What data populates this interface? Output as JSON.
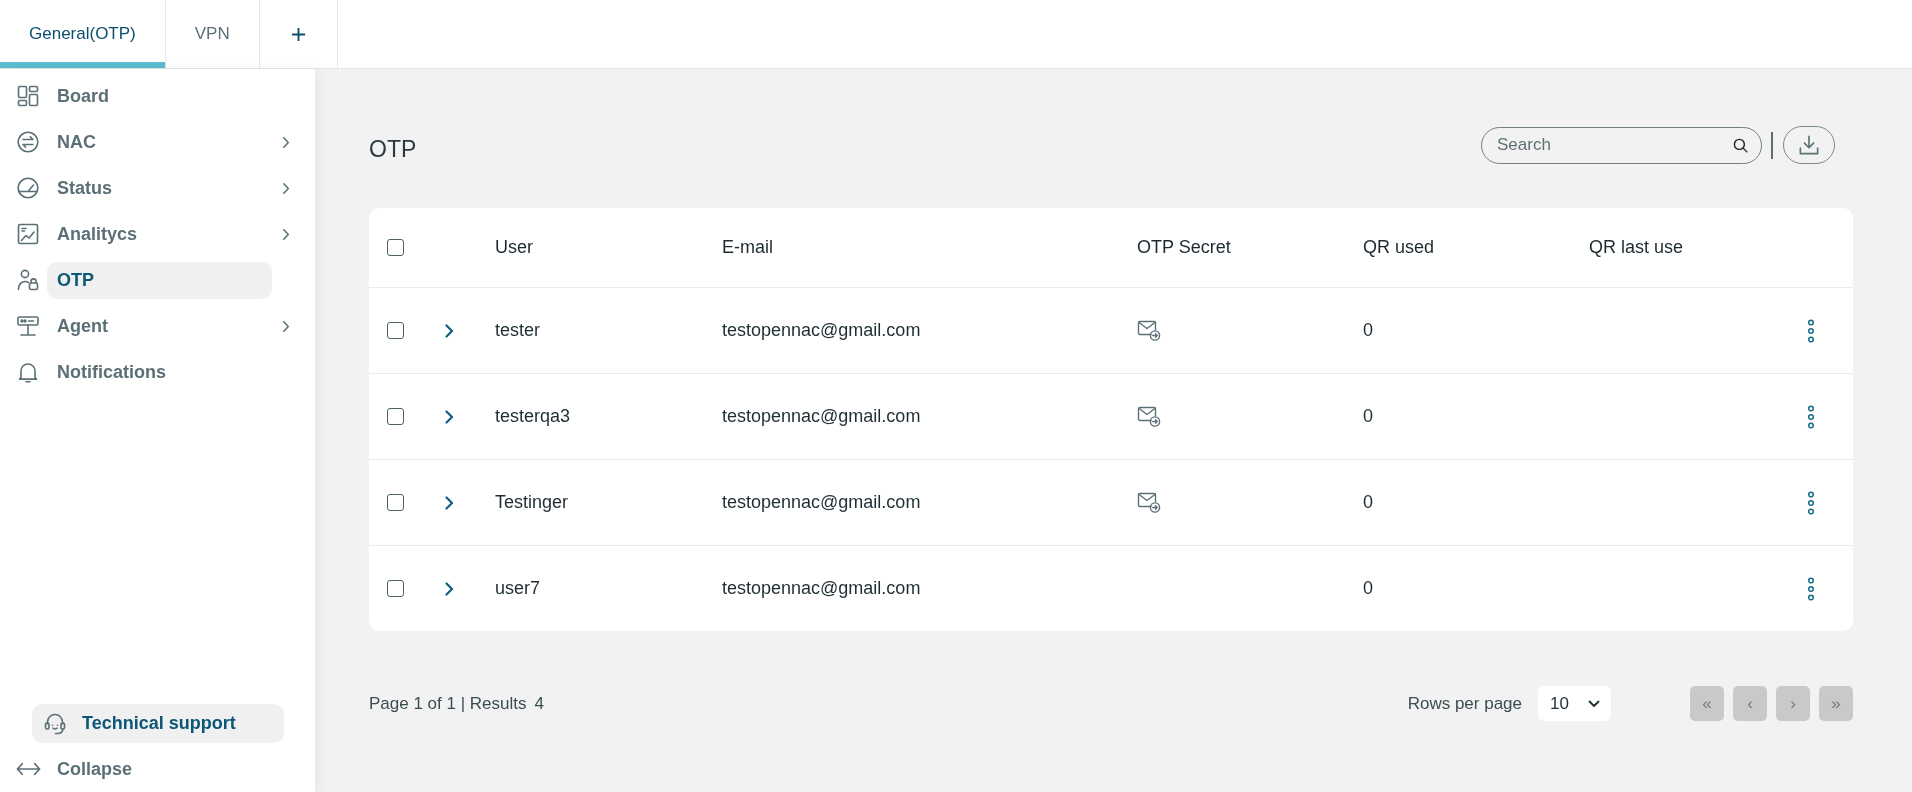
{
  "tabs": [
    {
      "label": "General(OTP)",
      "selected": true
    },
    {
      "label": "VPN",
      "selected": false
    }
  ],
  "sidebar": {
    "items": [
      {
        "label": "Board",
        "selected": false,
        "expandable": false
      },
      {
        "label": "NAC",
        "selected": false,
        "expandable": true
      },
      {
        "label": "Status",
        "selected": false,
        "expandable": true
      },
      {
        "label": "Analitycs",
        "selected": false,
        "expandable": true
      },
      {
        "label": "OTP",
        "selected": true,
        "expandable": false
      },
      {
        "label": "Agent",
        "selected": false,
        "expandable": true
      },
      {
        "label": "Notifications",
        "selected": false,
        "expandable": false
      }
    ],
    "support": {
      "label": "Technical support"
    },
    "collapse": {
      "label": "Collapse"
    }
  },
  "page": {
    "title": "OTP",
    "search": {
      "placeholder": "Search"
    }
  },
  "table": {
    "header_checked": false,
    "columns": [
      "User",
      "E-mail",
      "OTP Secret",
      "QR used",
      "QR last use"
    ],
    "rows": [
      {
        "checked": false,
        "expanded": false,
        "user": "tester",
        "email": "testopennac@gmail.com",
        "otp_secret_set": true,
        "qr_used": "0"
      },
      {
        "checked": false,
        "expanded": false,
        "user": "testerqa3",
        "email": "testopennac@gmail.com",
        "otp_secret_set": true,
        "qr_used": "0"
      },
      {
        "checked": false,
        "expanded": false,
        "user": "Testinger",
        "email": "testopennac@gmail.com",
        "otp_secret_set": true,
        "qr_used": "0"
      },
      {
        "checked": false,
        "expanded": false,
        "user": "user7",
        "email": "testopennac@gmail.com",
        "otp_secret_set": false,
        "qr_used": "0"
      }
    ]
  },
  "footer": {
    "summary": "Page 1 of 1 | Results",
    "count": "4",
    "rows_per_page_label": "Rows per page",
    "rows_per_page": "10",
    "pager": [
      {
        "label": "«",
        "disabled": true
      },
      {
        "label": "‹",
        "disabled": true
      },
      {
        "label": "›",
        "disabled": true
      },
      {
        "label": "»",
        "disabled": true
      }
    ]
  }
}
